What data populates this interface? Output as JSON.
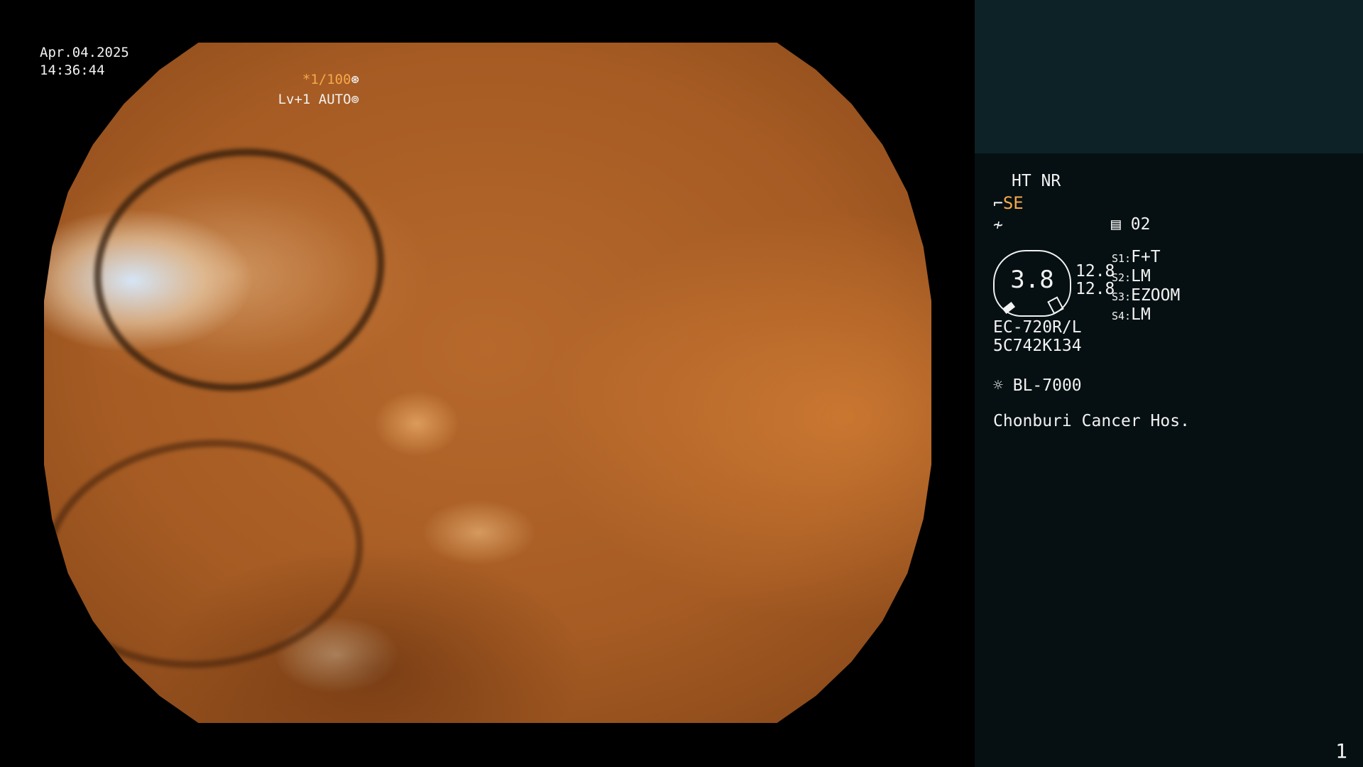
{
  "overlay": {
    "date": "Apr.04.2025",
    "time": "14:36:44",
    "shutter": "*1/100",
    "level": "Lv+1 AUTO"
  },
  "panel": {
    "ht_nr": "HT NR",
    "se": "SE",
    "memory": "02",
    "gauge_value": "3.8",
    "values": [
      "12.8",
      "12.8"
    ],
    "switches": [
      {
        "key": "S1:",
        "value": "F+T"
      },
      {
        "key": "S2:",
        "value": "LM"
      },
      {
        "key": "S3:",
        "value": "EZOOM"
      },
      {
        "key": "S4:",
        "value": "LM"
      }
    ],
    "scope_model": "EC-720R/L",
    "serial": "5C742K134",
    "light_source": "BL-7000",
    "hospital": "Chonburi Cancer Hos.",
    "page_number": "1"
  },
  "icons": [
    "aperture-icon",
    "iris-icon",
    "structure-enhance-icon",
    "modifier-icon",
    "memory-icon",
    "light-source-icon"
  ],
  "colors": {
    "accent": "#f6a94a",
    "panel_bg": "#061012",
    "panel_top_bg": "#0c2226"
  }
}
